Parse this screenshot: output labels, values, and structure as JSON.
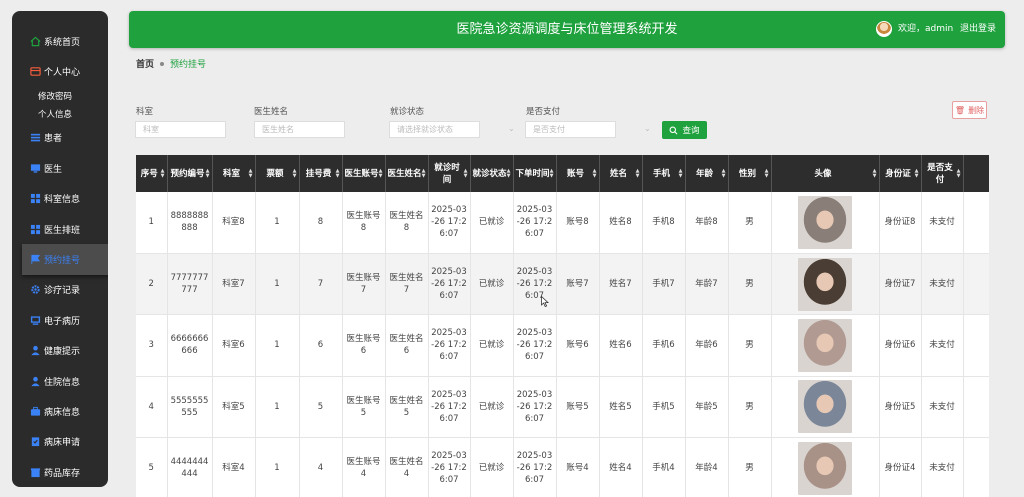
{
  "header": {
    "title": "医院急诊资源调度与床位管理系统开发",
    "welcome": "欢迎，admin",
    "logout": "退出登录"
  },
  "sidebar": {
    "items": [
      {
        "label": "系统首页",
        "icon": "home-icon"
      },
      {
        "label": "个人中心",
        "icon": "personal-center-icon"
      },
      {
        "label": "患者",
        "icon": "list-icon"
      },
      {
        "label": "医生",
        "icon": "monitor-icon"
      },
      {
        "label": "科室信息",
        "icon": "grid-icon"
      },
      {
        "label": "医生排班",
        "icon": "grid-icon"
      },
      {
        "label": "预约挂号",
        "icon": "flag-icon"
      },
      {
        "label": "诊疗记录",
        "icon": "gear-icon"
      },
      {
        "label": "电子病历",
        "icon": "computer-icon"
      },
      {
        "label": "健康提示",
        "icon": "user-icon"
      },
      {
        "label": "住院信息",
        "icon": "user-icon"
      },
      {
        "label": "病床信息",
        "icon": "briefcase-icon"
      },
      {
        "label": "病床申请",
        "icon": "clipboard-icon"
      },
      {
        "label": "药品库存",
        "icon": "box-icon"
      }
    ],
    "sub_items": [
      "修改密码",
      "个人信息"
    ]
  },
  "breadcrumb": {
    "home": "首页",
    "current": "预约挂号"
  },
  "filters": {
    "dept_label": "科室",
    "dept_placeholder": "科室",
    "doctor_label": "医生姓名",
    "doctor_placeholder": "医生姓名",
    "status_label": "就诊状态",
    "status_placeholder": "请选择就诊状态",
    "paid_label": "是否支付",
    "paid_placeholder": "是否支付",
    "search_label": "查询",
    "delete_label": "删除"
  },
  "table": {
    "headers": [
      "序号",
      "预约编号",
      "科室",
      "票额",
      "挂号费",
      "医生账号",
      "医生姓名",
      "就诊时间",
      "就诊状态",
      "下单时间",
      "账号",
      "姓名",
      "手机",
      "年龄",
      "性别",
      "头像",
      "身份证",
      "是否支付"
    ],
    "rows": [
      [
        "1",
        "8888888888",
        "科室8",
        "1",
        "8",
        "医生账号8",
        "医生姓名8",
        "2025-03-26 17:26:07",
        "已就诊",
        "2025-03-26 17:26:07",
        "账号8",
        "姓名8",
        "手机8",
        "年龄8",
        "男",
        "",
        "身份证8",
        "未支付"
      ],
      [
        "2",
        "7777777777",
        "科室7",
        "1",
        "7",
        "医生账号7",
        "医生姓名7",
        "2025-03-26 17:26:07",
        "已就诊",
        "2025-03-26 17:26:07",
        "账号7",
        "姓名7",
        "手机7",
        "年龄7",
        "男",
        "",
        "身份证7",
        "未支付"
      ],
      [
        "3",
        "6666666666",
        "科室6",
        "1",
        "6",
        "医生账号6",
        "医生姓名6",
        "2025-03-26 17:26:07",
        "已就诊",
        "2025-03-26 17:26:07",
        "账号6",
        "姓名6",
        "手机6",
        "年龄6",
        "男",
        "",
        "身份证6",
        "未支付"
      ],
      [
        "4",
        "5555555555",
        "科室5",
        "1",
        "5",
        "医生账号5",
        "医生姓名5",
        "2025-03-26 17:26:07",
        "已就诊",
        "2025-03-26 17:26:07",
        "账号5",
        "姓名5",
        "手机5",
        "年龄5",
        "男",
        "",
        "身份证5",
        "未支付"
      ],
      [
        "5",
        "4444444444",
        "科室4",
        "1",
        "4",
        "医生账号4",
        "医生姓名4",
        "2025-03-26 17:26:07",
        "已就诊",
        "2025-03-26 17:26:07",
        "账号4",
        "姓名4",
        "手机4",
        "年龄4",
        "男",
        "",
        "身份证4",
        "未支付"
      ]
    ],
    "photo_colors": [
      "#8a7f78",
      "#4a3d33",
      "#b09a92",
      "#7b8799",
      "#a89288"
    ]
  },
  "colors": {
    "accent": "#1fa13e",
    "sidebar": "#2b2b2b",
    "table_header": "#2d2d2d",
    "danger": "#e06060"
  }
}
